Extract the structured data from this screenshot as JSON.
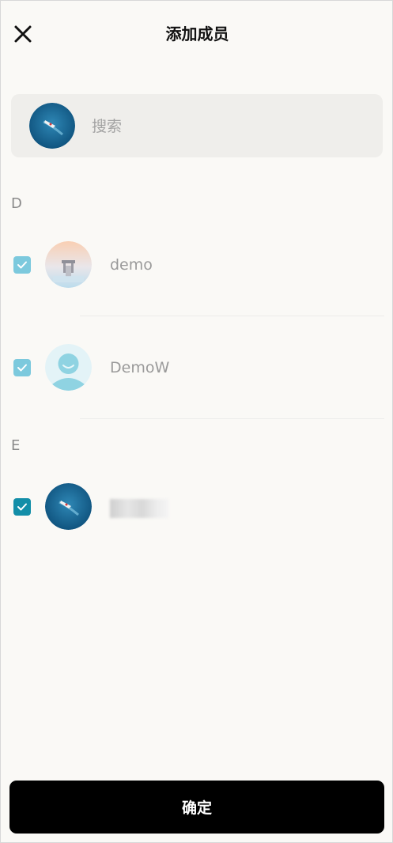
{
  "header": {
    "title": "添加成员",
    "close_icon": "close-icon"
  },
  "search": {
    "placeholder": "搜索",
    "value": ""
  },
  "sections": [
    {
      "letter": "D",
      "members": [
        {
          "name": "demo",
          "checked": true,
          "checkbox_color": "#7cc9dd",
          "avatar": "landscape-avatar"
        },
        {
          "name": "DemoW",
          "checked": true,
          "checkbox_color": "#7cc9dd",
          "avatar": "default-user-avatar"
        }
      ]
    },
    {
      "letter": "E",
      "members": [
        {
          "name": "",
          "checked": true,
          "checkbox_color": "#138ea8",
          "avatar": "boat-avatar"
        }
      ]
    }
  ],
  "footer": {
    "confirm_label": "确定"
  },
  "colors": {
    "background": "#faf9f6",
    "search_bg": "#efeeeb",
    "primary_button": "#000000",
    "checkbox_light": "#7cc9dd",
    "checkbox_dark": "#138ea8"
  }
}
